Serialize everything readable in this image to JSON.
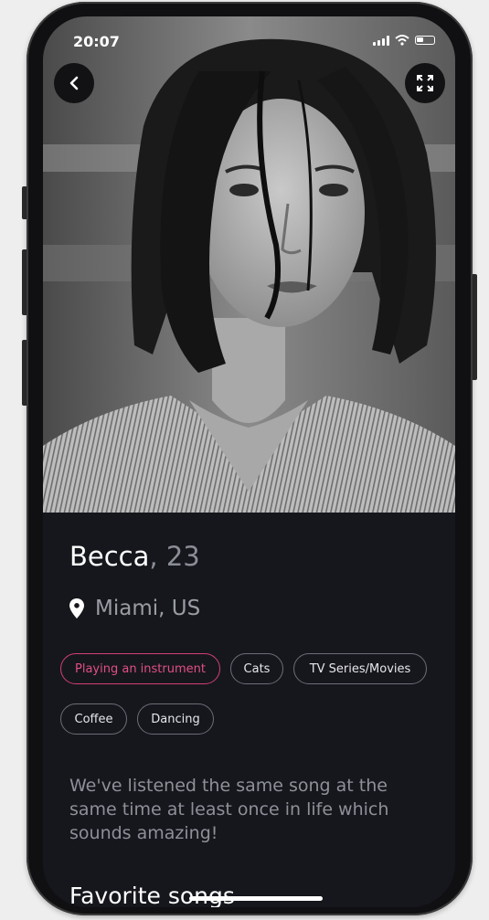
{
  "status_bar": {
    "time": "20:07"
  },
  "profile": {
    "name": "Becca",
    "age_text": ", 23",
    "location": "Miami, US",
    "interests": [
      {
        "label": "Playing an instrument",
        "active": true
      },
      {
        "label": "Cats",
        "active": false
      },
      {
        "label": "TV Series/Movies",
        "active": false
      },
      {
        "label": "Coffee",
        "active": false
      },
      {
        "label": "Dancing",
        "active": false
      }
    ],
    "bio": "We've listened the same song at the same time at least once in life which sounds amazing!",
    "section_title": "Favorite songs"
  },
  "colors": {
    "accent": "#d43f74",
    "background": "#16171d"
  },
  "icons": [
    "back-arrow-icon",
    "expand-icon",
    "location-pin-icon",
    "signal-icon",
    "wifi-icon",
    "battery-icon"
  ]
}
